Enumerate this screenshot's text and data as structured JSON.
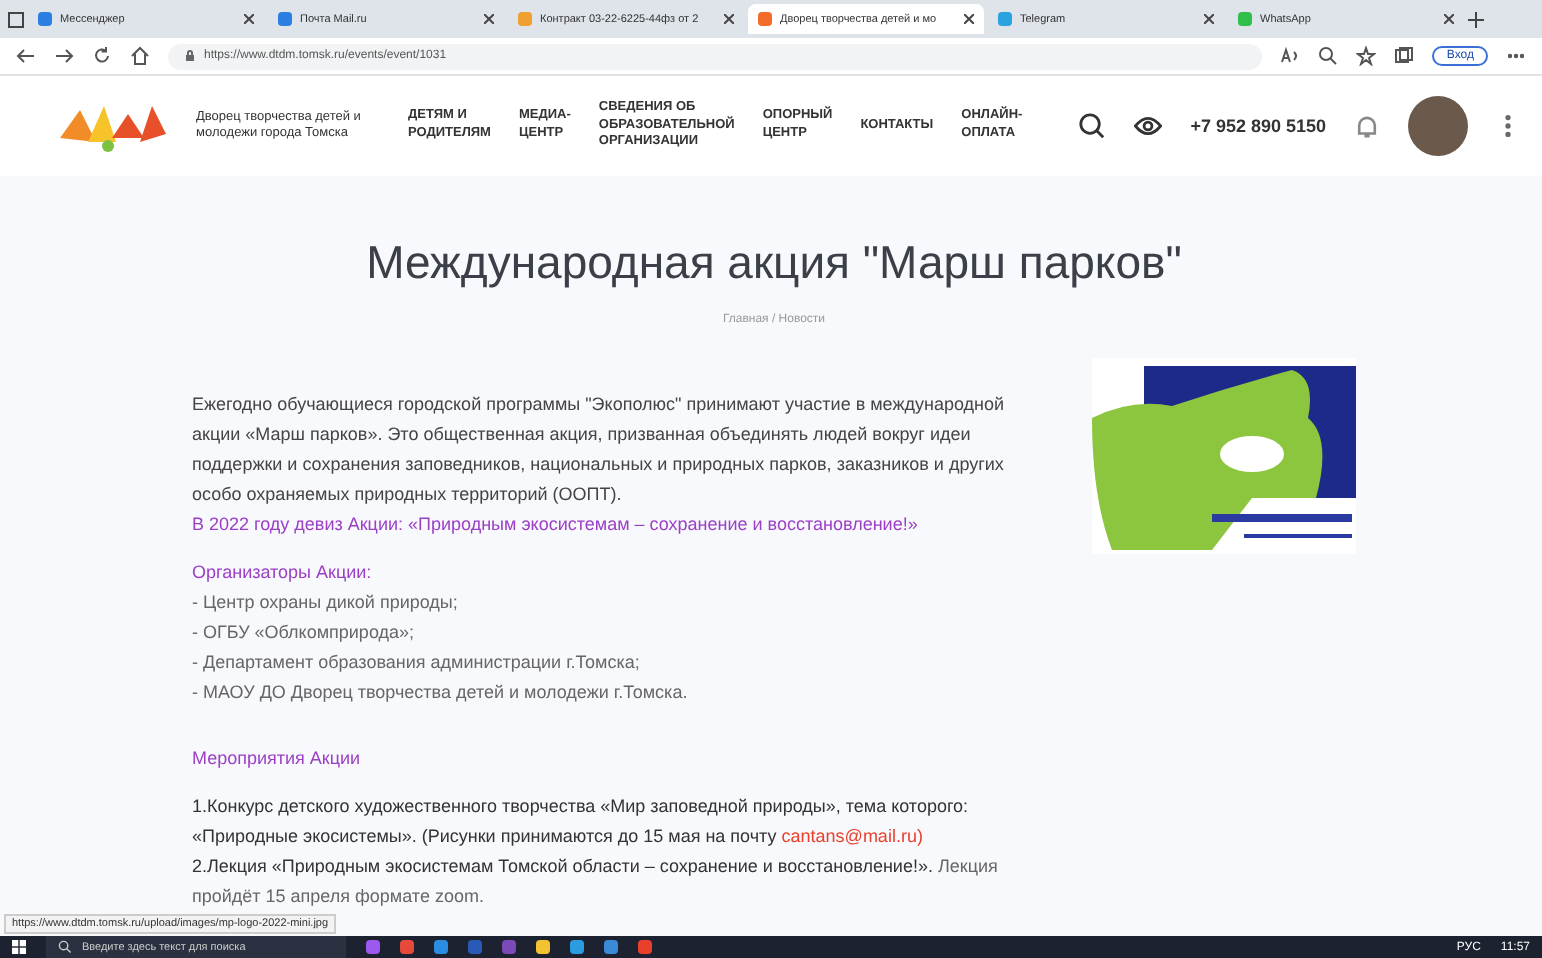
{
  "browser": {
    "tabs": [
      {
        "title": "Мессенджер",
        "selected": false,
        "color": "#2a7de1"
      },
      {
        "title": "Почта Mail.ru",
        "selected": false,
        "color": "#2a7de1"
      },
      {
        "title": "Контракт 03-22-6225-44фз от 2",
        "selected": false,
        "color": "#f0a030"
      },
      {
        "title": "Дворец творчества детей и мо",
        "selected": true,
        "color": "#f26b2a"
      },
      {
        "title": "Telegram",
        "selected": false,
        "color": "#2aa3e0"
      },
      {
        "title": "WhatsApp",
        "selected": false,
        "color": "#2fbf4a"
      }
    ],
    "url": "https://www.dtdm.tomsk.ru/events/event/1031",
    "signin": "Вход",
    "status_url": "https://www.dtdm.tomsk.ru/upload/images/mp-logo-2022-mini.jpg"
  },
  "site": {
    "name": "Дворец творчества детей и молодежи города Томска",
    "nav": [
      {
        "lines": [
          "ДЕТЯМ И",
          "РОДИТЕЛЯМ"
        ]
      },
      {
        "lines": [
          "МЕДИА-",
          "ЦЕНТР"
        ]
      },
      {
        "lines": [
          "СВЕДЕНИЯ ОБ",
          "ОБРАЗОВАТЕЛЬНОЙ",
          "ОРГАНИЗАЦИИ"
        ]
      },
      {
        "lines": [
          "ОПОРНЫЙ",
          "ЦЕНТР"
        ]
      },
      {
        "lines": [
          "КОНТАКТЫ"
        ]
      },
      {
        "lines": [
          "ОНЛАЙН-",
          "ОПЛАТА"
        ]
      }
    ],
    "phone": "+7 952 890 5150"
  },
  "article": {
    "title": "Международная акция \"Марш парков\"",
    "breadcrumb": "Главная / Новости",
    "intro": "Ежегодно обучающиеся городской программы \"Экополюс\" принимают участие в международной акции «Марш парков». Это общественная акция, призванная объединять людей вокруг идеи поддержки и сохранения заповедников, национальных и природных парков, заказников и других особо охраняемых природных территорий (ООПТ).",
    "motto": "В 2022 году девиз Акции: «Природным экосистемам – сохранение и восстановление!»",
    "organizers_heading": "Организаторы Акции:",
    "organizers": [
      "- Центр охраны дикой природы;",
      "- ОГБУ «Облкомприрода»;",
      "- Департамент образования администрации г.Томска;",
      "- МАОУ ДО Дворец творчества детей и молодежи г.Томска."
    ],
    "events_heading": "Мероприятия Акции",
    "events": [
      {
        "text": "1.Конкурс детского художественного творчества «Мир заповедной природы», тема которого: «Природные экосистемы». (Рисунки принимаются до 15 мая на почту ",
        "link": "cantans@mail.ru)"
      },
      {
        "text": "2.Лекция «Природным экосистемам Томской области – сохранение и восстановление!». ",
        "note": "Лекция пройдёт 15 апреля формате zoom."
      }
    ]
  },
  "taskbar": {
    "search_placeholder": "Введите здесь текст для поиска",
    "time": "11:57",
    "language": "РУС"
  }
}
